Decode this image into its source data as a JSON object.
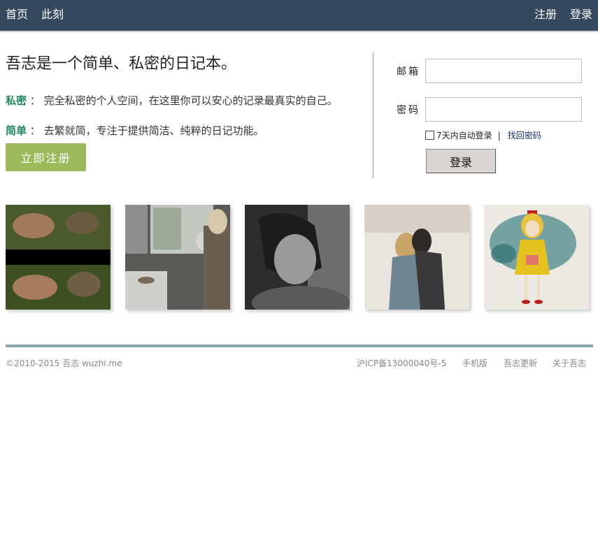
{
  "nav": {
    "home": "首页",
    "now": "此刻",
    "register": "注册",
    "login": "登录"
  },
  "intro": {
    "headline": "吾志是一个简单、私密的日记本。",
    "features": [
      {
        "key": "私密",
        "sep": "：",
        "text": "完全私密的个人空间，在这里你可以安心的记录最真实的自己。"
      },
      {
        "key": "简单",
        "sep": "：",
        "text": "去繁就简，专注于提供简洁、纯粹的日记功能。"
      }
    ],
    "signup_label": "立即注册"
  },
  "login_form": {
    "email_label": "邮箱",
    "password_label": "密码",
    "email_value": "",
    "password_value": "",
    "remember_label": "7天内自动登录",
    "separator": "|",
    "forgot_label": "找回密码",
    "submit_label": "登录"
  },
  "photos": [
    "photo-1",
    "photo-2",
    "photo-3",
    "photo-4",
    "photo-5"
  ],
  "footer": {
    "copyright": "©2010-2015 吾志 wuzhi.me",
    "icp": "沪ICP备13000040号-5",
    "links": [
      "手机版",
      "吾志更新",
      "关于吾志"
    ]
  },
  "colors": {
    "topbar": "#34495e",
    "accent_green": "#1d8a5a",
    "signup_button": "#9dba5a",
    "footer_line": "#8fa5ad"
  }
}
